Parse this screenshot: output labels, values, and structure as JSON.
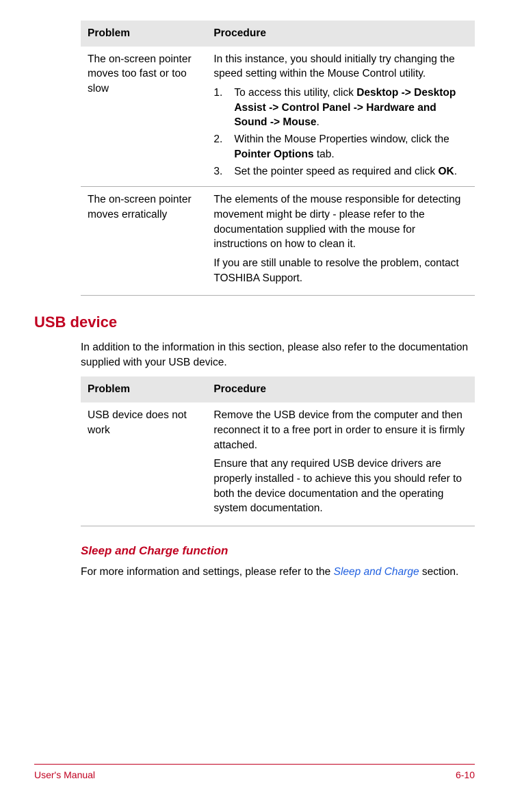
{
  "table1": {
    "headers": {
      "problem": "Problem",
      "procedure": "Procedure"
    },
    "rows": [
      {
        "problem": "The on-screen pointer moves too fast or too slow",
        "procedure_intro": "In this instance, you should initially try changing the speed setting within the Mouse Control utility.",
        "step1_pre": "To access this utility, click ",
        "step1_bold": "Desktop -> Desktop Assist -> Control Panel -> Hardware and Sound -> Mouse",
        "step1_post": ".",
        "step2_pre": "Within the Mouse Properties window, click the ",
        "step2_bold": "Pointer Options",
        "step2_post": " tab.",
        "step3_pre": "Set the pointer speed as required and click ",
        "step3_bold": "OK",
        "step3_post": "."
      },
      {
        "problem": "The on-screen pointer moves erratically",
        "procedure_p1": "The elements of the mouse responsible for detecting movement might be dirty - please refer to the documentation supplied with the mouse for instructions on how to clean it.",
        "procedure_p2": "If you are still unable to resolve the problem, contact TOSHIBA Support."
      }
    ]
  },
  "usb_section": {
    "heading": "USB device",
    "intro": "In addition to the information in this section, please also refer to the documentation supplied with your USB device."
  },
  "table2": {
    "headers": {
      "problem": "Problem",
      "procedure": "Procedure"
    },
    "rows": [
      {
        "problem": "USB device does not work",
        "procedure_p1": "Remove the USB device from the computer and then reconnect it to a free port in order to ensure it is firmly attached.",
        "procedure_p2": "Ensure that any required USB device drivers are properly installed - to achieve this you should refer to both the device documentation and the operating system documentation."
      }
    ]
  },
  "sleep_section": {
    "heading": "Sleep and Charge function",
    "text_pre": "For more information and settings, please refer to the ",
    "link": "Sleep and Charge",
    "text_post": " section."
  },
  "footer": {
    "left": "User's Manual",
    "right": "6-10"
  }
}
